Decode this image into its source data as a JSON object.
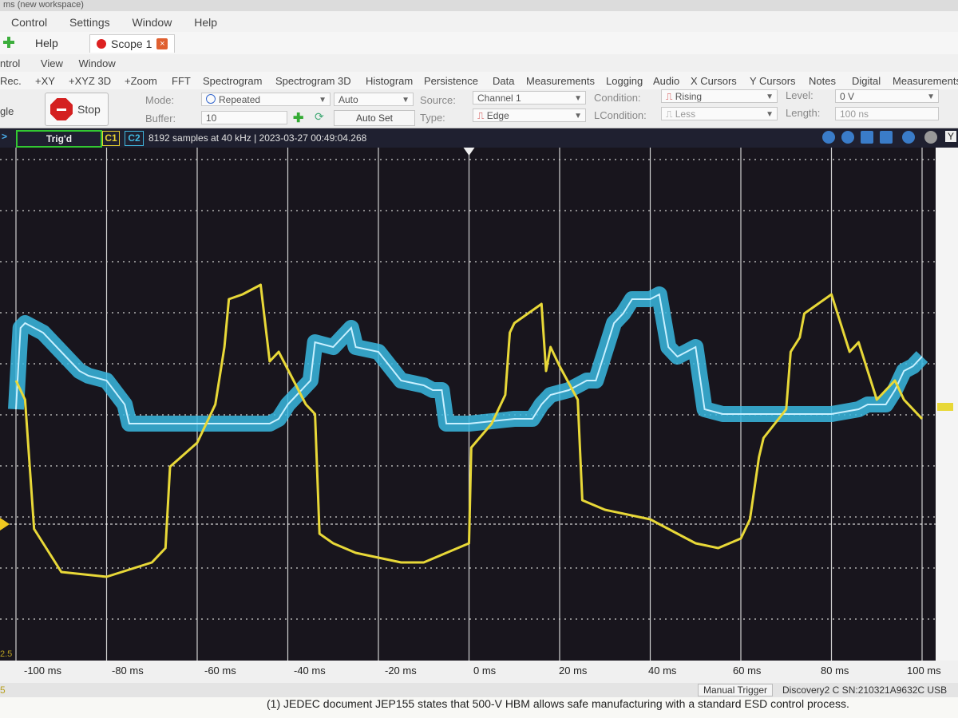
{
  "window": {
    "title": "ms (new workspace)"
  },
  "menu": [
    "Control",
    "Settings",
    "Window",
    "Help"
  ],
  "tabs": {
    "help_label": "Help",
    "scope_label": "Scope 1",
    "close_symbol": "×"
  },
  "submenu": [
    "ntrol",
    "View",
    "Window"
  ],
  "toolbar": [
    "Rec.",
    "+XY",
    "+XYZ 3D",
    "+Zoom",
    "FFT",
    "Spectrogram",
    "Spectrogram 3D",
    "Histogram",
    "Persistence",
    "Data",
    "Measurements",
    "Logging",
    "Audio",
    "X Cursors",
    "Y Cursors",
    "Notes",
    "Digital",
    "Measurements"
  ],
  "controls": {
    "left_label": "gle",
    "stop_label": "Stop",
    "mode_label": "Mode:",
    "mode_value": "Repeated",
    "auto_value": "Auto",
    "buffer_label": "Buffer:",
    "buffer_value": "10",
    "autoset_label": "Auto Set",
    "source_label": "Source:",
    "source_value": "Channel 1",
    "type_label": "Type:",
    "type_value": "Edge",
    "condition_label": "Condition:",
    "condition_value": "Rising",
    "lcondition_label": "LCondition:",
    "lcondition_value": "Less",
    "level_label": "Level:",
    "level_value": "0 V",
    "length_label": "Length:",
    "length_value": "100 ns"
  },
  "scope_header": {
    "status": "Trig'd",
    "ch1": "C1",
    "ch2": "C2",
    "info": "8192 samples at 40 kHz | 2023-03-27 00:49:04.268",
    "right_letter": "Y"
  },
  "x_ticks": [
    "-100 ms",
    "-80 ms",
    "-60 ms",
    "-40 ms",
    "-20 ms",
    "0 ms",
    "20 ms",
    "40 ms",
    "60 ms",
    "80 ms",
    "100 ms"
  ],
  "left_edge_label": "2.5",
  "left_axis_partial": "5",
  "status": {
    "manual_trigger": "Manual Trigger",
    "device": "Discovery2 C SN:210321A9632C USB"
  },
  "paper_text": "(1)    JEDEC document JEP155 states that 500-V HBM allows safe manufacturing with a standard ESD control process.",
  "colors": {
    "ch1": "#e8d838",
    "ch2": "#3ab8e0",
    "plot_bg": "#18151d",
    "trig_green": "#32c832"
  },
  "chart_data": {
    "type": "line",
    "xlabel": "",
    "ylabel": "",
    "xlim": [
      -100,
      100
    ],
    "grid": true,
    "series": [
      {
        "name": "C1",
        "x": [
          -100,
          -98,
          -96,
          -90,
          -80,
          -70,
          -67,
          -66,
          -60,
          -56,
          -54,
          -53,
          -50,
          -46,
          -44,
          -42,
          -36,
          -34,
          -33,
          -30,
          -25,
          -20,
          -15,
          -10,
          -5,
          0,
          0.5,
          5,
          8,
          9,
          10,
          16,
          17,
          18,
          20,
          24,
          25,
          30,
          40,
          50,
          55,
          60,
          62,
          64,
          65,
          70,
          71,
          73,
          74,
          80,
          84,
          86,
          90,
          92,
          94,
          96,
          100
        ],
        "y": [
          0.8,
          0.4,
          -2.3,
          -3.2,
          -3.3,
          -3.0,
          -2.7,
          -1.0,
          -0.5,
          0.3,
          1.5,
          2.5,
          2.6,
          2.8,
          1.2,
          1.4,
          0.3,
          0.1,
          -2.4,
          -2.6,
          -2.8,
          -2.9,
          -3.0,
          -3.0,
          -2.8,
          -2.6,
          -0.6,
          -0.1,
          0.5,
          1.8,
          2.0,
          2.4,
          1.0,
          1.5,
          1.1,
          0.4,
          -1.7,
          -1.9,
          -2.1,
          -2.6,
          -2.7,
          -2.5,
          -2.1,
          -0.8,
          -0.4,
          0.2,
          1.4,
          1.7,
          2.2,
          2.6,
          1.4,
          1.6,
          0.4,
          0.6,
          0.8,
          0.4,
          0.0
        ]
      },
      {
        "name": "C2",
        "x": [
          -100,
          -99,
          -98,
          -94,
          -88,
          -86,
          -84,
          -80,
          -76,
          -75,
          -70,
          -60,
          -56,
          -55,
          -50,
          -46,
          -44,
          -42,
          -40,
          -38,
          -36,
          -35,
          -34,
          -30,
          -26,
          -25,
          -20,
          -15,
          -10,
          -8,
          -6,
          -5,
          0,
          10,
          14,
          16,
          18,
          22,
          26,
          28,
          30,
          32,
          34,
          36,
          40,
          42,
          44,
          46,
          50,
          52,
          56,
          58,
          64,
          70,
          76,
          80,
          86,
          88,
          92,
          94,
          96,
          98,
          99,
          100
        ],
        "y": [
          0.2,
          1.9,
          2.0,
          1.8,
          1.2,
          1.0,
          0.9,
          0.8,
          0.3,
          -0.1,
          -0.1,
          -0.1,
          -0.1,
          -0.1,
          -0.1,
          -0.1,
          -0.1,
          0.0,
          0.3,
          0.5,
          0.7,
          0.8,
          1.6,
          1.5,
          1.9,
          1.5,
          1.4,
          0.8,
          0.7,
          0.6,
          0.6,
          -0.1,
          -0.1,
          0.0,
          0.0,
          0.3,
          0.5,
          0.6,
          0.8,
          0.8,
          1.4,
          2.0,
          2.2,
          2.5,
          2.5,
          2.6,
          1.5,
          1.3,
          1.5,
          0.2,
          0.1,
          0.1,
          0.1,
          0.1,
          0.1,
          0.1,
          0.2,
          0.3,
          0.3,
          0.6,
          1.0,
          1.1,
          1.2,
          1.3
        ]
      }
    ]
  }
}
